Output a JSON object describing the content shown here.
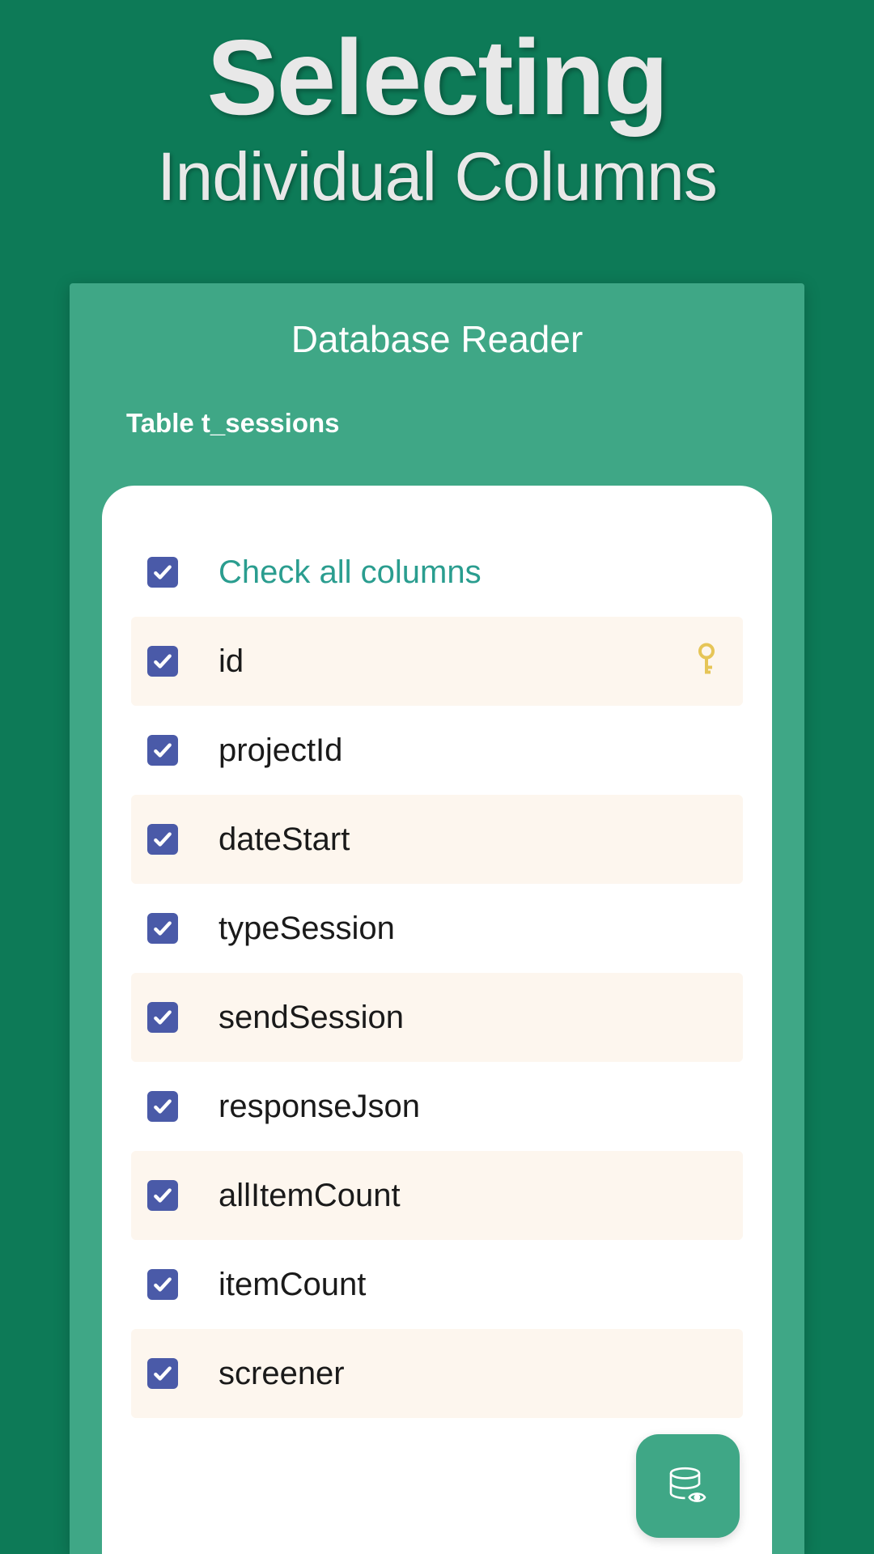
{
  "header": {
    "title_main": "Selecting",
    "title_sub": "Individual Columns"
  },
  "panel": {
    "title": "Database Reader",
    "table_label": "Table t_sessions"
  },
  "columns": {
    "check_all_label": "Check all columns",
    "items": [
      {
        "name": "id",
        "checked": true,
        "is_key": true
      },
      {
        "name": "projectId",
        "checked": true,
        "is_key": false
      },
      {
        "name": "dateStart",
        "checked": true,
        "is_key": false
      },
      {
        "name": "typeSession",
        "checked": true,
        "is_key": false
      },
      {
        "name": "sendSession",
        "checked": true,
        "is_key": false
      },
      {
        "name": "responseJson",
        "checked": true,
        "is_key": false
      },
      {
        "name": "allItemCount",
        "checked": true,
        "is_key": false
      },
      {
        "name": "itemCount",
        "checked": true,
        "is_key": false
      },
      {
        "name": "screener",
        "checked": true,
        "is_key": false
      }
    ]
  },
  "colors": {
    "background": "#0d7a57",
    "panel": "#3fa786",
    "checkbox": "#4a5aa8",
    "accent_text": "#2a9d8f",
    "stripe": "#fdf6ee",
    "key_icon": "#e6c557"
  }
}
